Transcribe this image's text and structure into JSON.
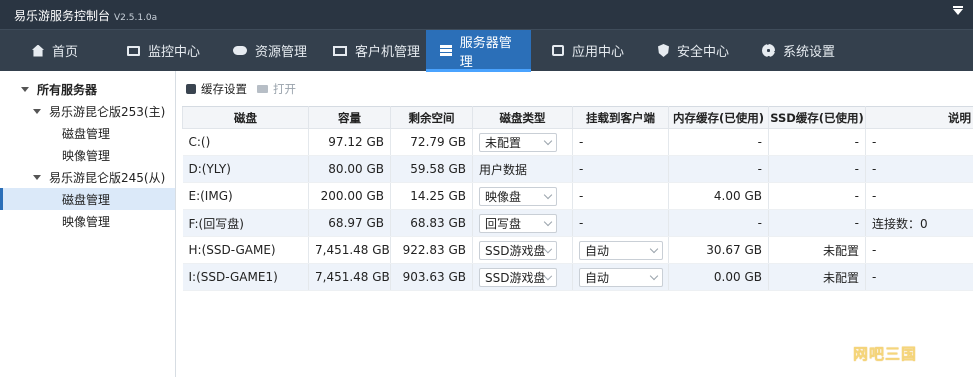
{
  "window": {
    "title": "易乐游服务控制台",
    "version": "V2.5.1.0a"
  },
  "nav": {
    "items": [
      {
        "label": "首页",
        "icon": "home-icon"
      },
      {
        "label": "监控中心",
        "icon": "monitor-icon"
      },
      {
        "label": "资源管理",
        "icon": "gamepad-icon"
      },
      {
        "label": "客户机管理",
        "icon": "desktop-icon"
      },
      {
        "label": "服务器管理",
        "icon": "server-icon",
        "active": true
      },
      {
        "label": "应用中心",
        "icon": "app-icon"
      },
      {
        "label": "安全中心",
        "icon": "shield-icon"
      },
      {
        "label": "系统设置",
        "icon": "gear-icon"
      }
    ]
  },
  "sidebar": {
    "root": "所有服务器",
    "servers": [
      {
        "label": "易乐游昆仑版253(主)",
        "children": [
          "磁盘管理",
          "映像管理"
        ]
      },
      {
        "label": "易乐游昆仑版245(从)",
        "children": [
          "磁盘管理",
          "映像管理"
        ],
        "selected_child": "磁盘管理"
      }
    ]
  },
  "toolbar": {
    "cache_label": "缓存设置",
    "open_label": "打开"
  },
  "table": {
    "headers": [
      "磁盘",
      "容量",
      "剩余空间",
      "磁盘类型",
      "挂载到客户端",
      "内存缓存(已使用)",
      "SSD缓存(已使用)",
      "说明"
    ],
    "rows": [
      {
        "disk": "C:()",
        "capacity": "97.12 GB",
        "free": "72.79 GB",
        "type": "未配置",
        "type_select": true,
        "mount": "-",
        "mount_select": false,
        "mem": "-",
        "ssd": "-",
        "note": "-"
      },
      {
        "disk": "D:(YLY)",
        "capacity": "80.00 GB",
        "free": "59.58 GB",
        "type": "用户数据",
        "type_select": false,
        "mount": "-",
        "mount_select": false,
        "mem": "-",
        "ssd": "-",
        "note": "-"
      },
      {
        "disk": "E:(IMG)",
        "capacity": "200.00 GB",
        "free": "14.25 GB",
        "type": "映像盘",
        "type_select": true,
        "mount": "-",
        "mount_select": false,
        "mem": "4.00 GB",
        "ssd": "-",
        "note": "-"
      },
      {
        "disk": "F:(回写盘)",
        "capacity": "68.97 GB",
        "free": "68.83 GB",
        "type": "回写盘",
        "type_select": true,
        "mount": "-",
        "mount_select": false,
        "mem": "-",
        "ssd": "-",
        "note": "连接数：0"
      },
      {
        "disk": "H:(SSD-GAME)",
        "capacity": "7,451.48 GB",
        "free": "922.83 GB",
        "type": "SSD游戏盘",
        "type_select": true,
        "mount": "自动",
        "mount_select": true,
        "mem": "30.67 GB",
        "ssd": "未配置",
        "note": "-"
      },
      {
        "disk": "I:(SSD-GAME1)",
        "capacity": "7,451.48 GB",
        "free": "903.63 GB",
        "type": "SSD游戏盘",
        "type_select": true,
        "mount": "自动",
        "mount_select": true,
        "mem": "0.00 GB",
        "ssd": "未配置",
        "note": "-"
      }
    ]
  },
  "watermark": "网吧三国"
}
